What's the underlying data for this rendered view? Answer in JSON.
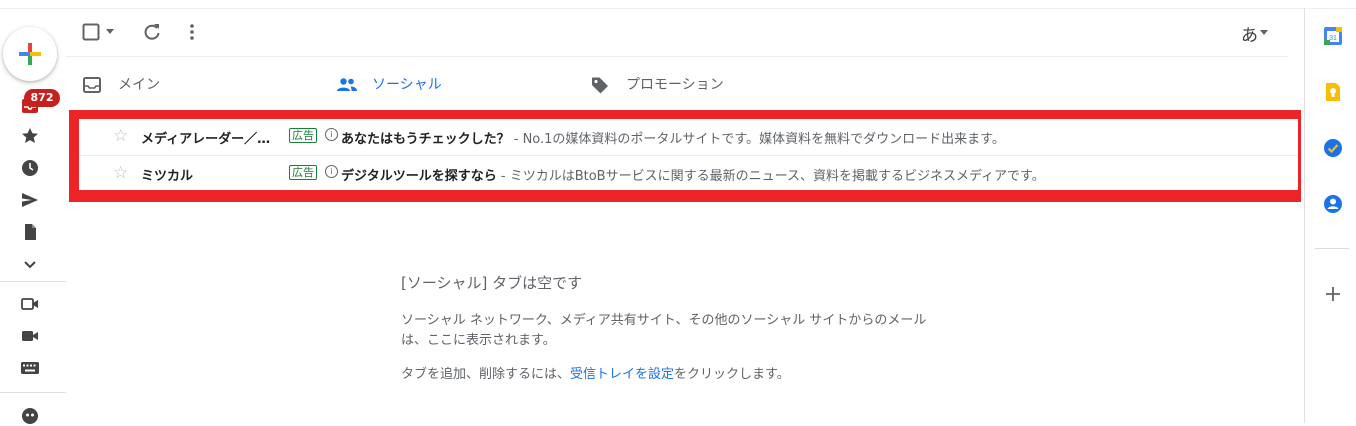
{
  "left_rail": {
    "unread_count": "872"
  },
  "toolbar": {
    "input_method": "あ"
  },
  "tabs": [
    {
      "label": "メイン",
      "icon": "inbox-icon"
    },
    {
      "label": "ソーシャル",
      "icon": "people-icon",
      "active": true
    },
    {
      "label": "プロモーション",
      "icon": "tag-icon"
    }
  ],
  "messages": [
    {
      "sender": "メディアレーダー／…",
      "ad_label": "広告",
      "subject": "あなたはもうチェックした？",
      "snippet": " - No.1の媒体資料のポータルサイトです。媒体資料を無料でダウンロード出来ます。"
    },
    {
      "sender": "ミツカル",
      "ad_label": "広告",
      "subject": "デジタルツールを探すなら",
      "snippet": " - ミツカルはBtoBサービスに関する最新のニュース、資料を掲載するビジネスメディアです。"
    }
  ],
  "empty_state": {
    "title": "[ソーシャル] タブは空です",
    "description": "ソーシャル ネットワーク、メディア共有サイト、その他のソーシャル サイトからのメールは、ここに表示されます。",
    "action_prefix": "タブを追加、削除するには、",
    "action_link": "受信トレイを設定",
    "action_suffix": "をクリックします。"
  },
  "colors": {
    "accent": "#1a73e8",
    "highlight": "#ec2428",
    "badge": "#c5221f",
    "ad": "#188038"
  }
}
